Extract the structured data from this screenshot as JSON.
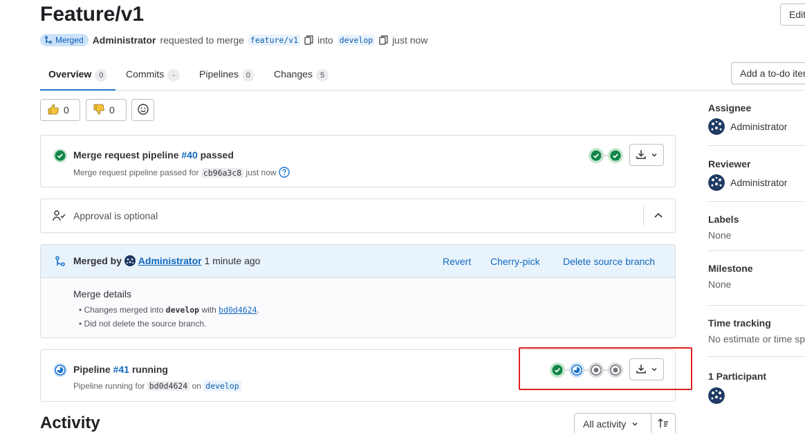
{
  "header": {
    "title": "Feature/v1",
    "edit_label": "Edit",
    "todo_label": "Add a to-do item"
  },
  "meta": {
    "status_badge": "Merged",
    "author": "Administrator",
    "requested_text": "requested to merge",
    "source_branch": "feature/v1",
    "into_text": "into",
    "target_branch": "develop",
    "time": "just now"
  },
  "tabs": [
    {
      "label": "Overview",
      "count": "0"
    },
    {
      "label": "Commits",
      "count": "-"
    },
    {
      "label": "Pipelines",
      "count": "0"
    },
    {
      "label": "Changes",
      "count": "5"
    }
  ],
  "reactions": {
    "thumbs_up": "0",
    "thumbs_down": "0"
  },
  "mr_pipeline": {
    "title_prefix": "Merge request pipeline",
    "number": "#40",
    "title_suffix": "passed",
    "sub_prefix": "Merge request pipeline passed for",
    "sha": "cb96a3c8",
    "time": "just now"
  },
  "approval": {
    "text": "Approval is optional"
  },
  "merged": {
    "prefix": "Merged by",
    "user": "Administrator",
    "time": "1 minute ago",
    "actions": [
      "Revert",
      "Cherry-pick",
      "Delete source branch"
    ],
    "details_title": "Merge details",
    "detail1_prefix": "Changes merged into",
    "detail1_branch": "develop",
    "detail1_mid": "with",
    "detail1_sha": "bd0d4624",
    "detail1_end": ".",
    "detail2": "Did not delete the source branch."
  },
  "pipeline": {
    "title_prefix": "Pipeline",
    "number": "#41",
    "title_suffix": "running",
    "sub_prefix": "Pipeline running for",
    "sha": "bd0d4624",
    "on_text": "on",
    "branch": "develop"
  },
  "activity": {
    "heading": "Activity",
    "filter_label": "All activity"
  },
  "sidebar": {
    "assignee_label": "Assignee",
    "assignee": "Administrator",
    "reviewer_label": "Reviewer",
    "reviewer": "Administrator",
    "labels_label": "Labels",
    "labels_value": "None",
    "milestone_label": "Milestone",
    "milestone_value": "None",
    "time_label": "Time tracking",
    "time_value": "No estimate or time spent",
    "participants_label": "1 Participant"
  },
  "colors": {
    "success": "#108548",
    "running": "#1f75cb",
    "pending": "#737278",
    "link": "#1068bf",
    "highlight": "#e02020"
  }
}
